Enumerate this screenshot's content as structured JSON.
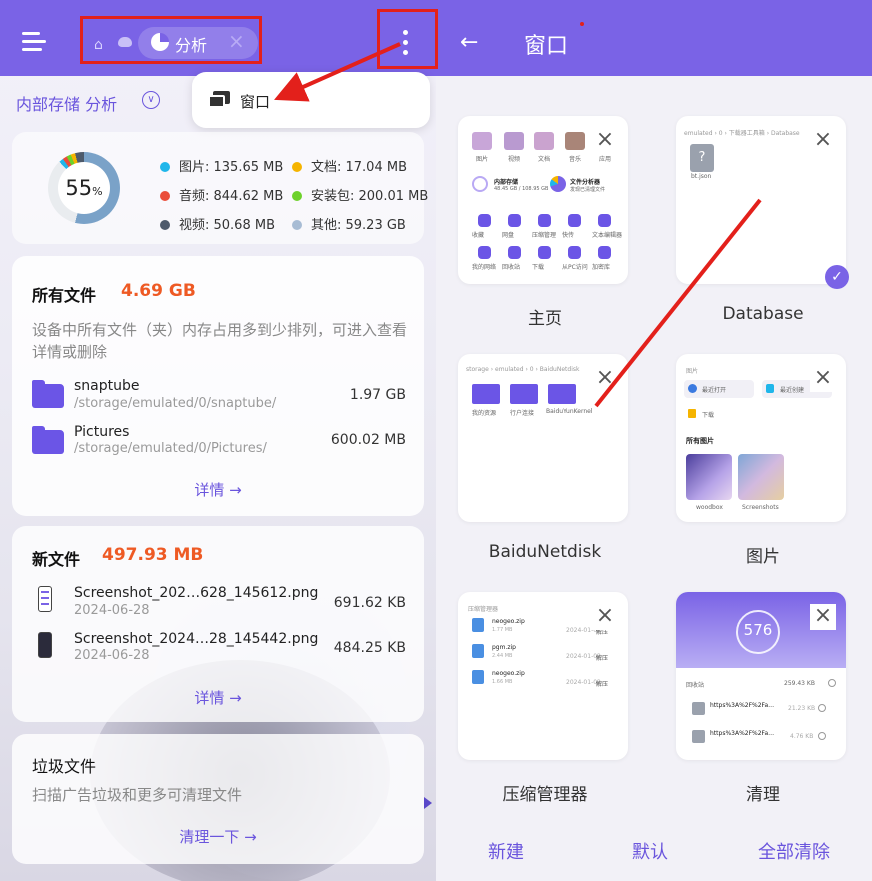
{
  "left": {
    "tab": {
      "label": "分析"
    },
    "breadcrumb": "内部存储 分析",
    "menu": {
      "window_label": "窗口"
    },
    "storage": {
      "percent": "55",
      "percent_unit": "%",
      "legend": [
        {
          "label": "图片: 135.65 MB",
          "color": "#1fb6ea"
        },
        {
          "label": "文档: 17.04 MB",
          "color": "#f5b400"
        },
        {
          "label": "音频: 844.62 MB",
          "color": "#ea4d3a"
        },
        {
          "label": "安装包: 200.01 MB",
          "color": "#6dd12b"
        },
        {
          "label": "视频: 50.68 MB",
          "color": "#4d5a6b"
        },
        {
          "label": "其他: 59.23 GB",
          "color": "#a7bcd4"
        }
      ]
    },
    "all_files": {
      "title": "所有文件",
      "size": "4.69 GB",
      "desc": "设备中所有文件（夹）内存占用多到少排列，可进入查看详情或删除",
      "items": [
        {
          "name": "snaptube",
          "path": "/storage/emulated/0/snaptube/",
          "size": "1.97 GB"
        },
        {
          "name": "Pictures",
          "path": "/storage/emulated/0/Pictures/",
          "size": "600.02 MB"
        }
      ],
      "detail": "详情 →"
    },
    "new_files": {
      "title": "新文件",
      "size": "497.93 MB",
      "items": [
        {
          "name": "Screenshot_202…628_145612.png",
          "date": "2024-06-28",
          "size": "691.62 KB"
        },
        {
          "name": "Screenshot_2024…28_145442.png",
          "date": "2024-06-28",
          "size": "484.25 KB"
        }
      ],
      "detail": "详情 →"
    },
    "junk": {
      "title": "垃圾文件",
      "desc": "扫描广告垃圾和更多可清理文件",
      "action": "清理一下 →"
    }
  },
  "right": {
    "title": "窗口",
    "windows": [
      {
        "label": "主页",
        "preview": {
          "categories": [
            "图片",
            "视频",
            "文档",
            "音乐",
            "应用"
          ],
          "storage_name": "内部存储",
          "storage_detail": "48.45 GB / 108.95 GB",
          "analyzer_name": "文件分析器",
          "analyzer_detail": "发现已清理文件",
          "tools_row1": [
            "收藏",
            "网盘",
            "压缩管理",
            "快传",
            "文本编辑器"
          ],
          "tools_row2": [
            "我的网络",
            "回收站",
            "下载",
            "从PC访问",
            "加密库"
          ]
        }
      },
      {
        "label": "Database",
        "preview": {
          "path": "emulated › 0 › 下载器工具箱 › Database",
          "file": "bt.json"
        }
      },
      {
        "label": "BaiduNetdisk",
        "preview": {
          "path": "storage › emulated › 0 › BaiduNetdisk",
          "folders": [
            "我的资源",
            "行户连接",
            "BaiduYunKernel"
          ]
        }
      },
      {
        "label": "图片",
        "preview": {
          "header": "图片",
          "recent_open": "最近打开",
          "recent_create": "最近创建",
          "download": "下载",
          "all_label": "所有图片",
          "albums": [
            "woodbox",
            "Screenshots"
          ]
        }
      },
      {
        "label": "压缩管理器",
        "preview": {
          "header": "压缩管理器",
          "files": [
            {
              "name": "neogeo.zip",
              "size": "1.77 MB",
              "date": "2024-01-02",
              "action": "解压"
            },
            {
              "name": "pgm.zip",
              "size": "2.44 MB",
              "date": "2024-01-02",
              "action": "解压"
            },
            {
              "name": "neogeo.zip",
              "size": "1.66 MB",
              "date": "2024-01-02",
              "action": "解压"
            }
          ]
        }
      },
      {
        "label": "清理",
        "preview": {
          "score": "576",
          "bin_label": "回收站",
          "bin_size": "259.43 KB",
          "items": [
            {
              "name": "https%3A%2F%2Fa…",
              "size": "21.23 KB"
            },
            {
              "name": "https%3A%2F%2Fa…",
              "size": "4.76 KB"
            }
          ]
        }
      }
    ],
    "buttons": {
      "new": "新建",
      "default": "默认",
      "clear_all": "全部清除"
    }
  },
  "colors": {
    "accent": "#7a63e6",
    "annotation": "#e3201b",
    "highlight": "#ee5a24"
  }
}
